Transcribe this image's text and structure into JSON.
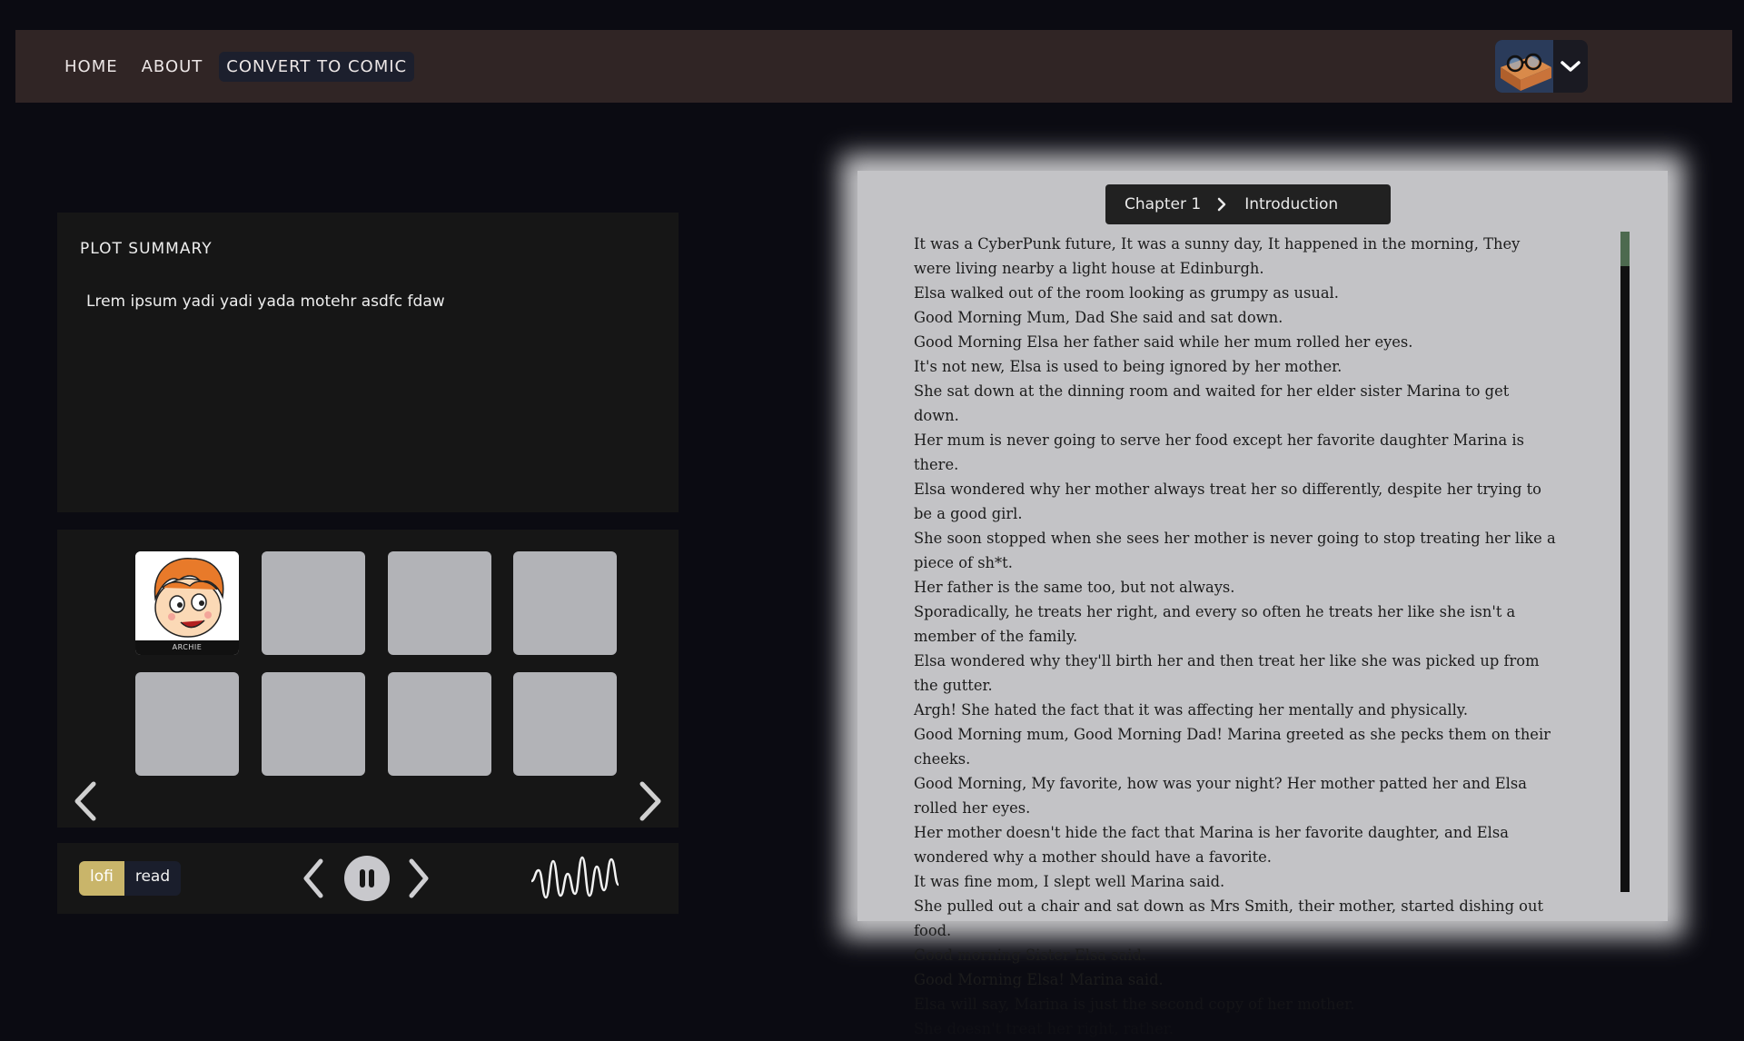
{
  "nav": {
    "home": "HOME",
    "about": "ABOUT",
    "convert": "CONVERT TO COMIC"
  },
  "profile": {
    "avatar_icon": "reading-glasses-book-icon",
    "menu_icon": "chevron-down-icon"
  },
  "plot": {
    "title": "PLOT SUMMARY",
    "text": "Lrem ipsum yadi yadi yada motehr asdfc fdaw"
  },
  "characters": {
    "tiles": [
      {
        "label": "ARCHIE",
        "filled": true
      },
      {
        "label": "",
        "filled": false
      },
      {
        "label": "",
        "filled": false
      },
      {
        "label": "",
        "filled": false
      },
      {
        "label": "",
        "filled": false
      },
      {
        "label": "",
        "filled": false
      },
      {
        "label": "",
        "filled": false
      },
      {
        "label": "",
        "filled": false
      }
    ]
  },
  "player": {
    "mode_lofi": "lofi",
    "mode_read": "read",
    "active_mode": "lofi",
    "state": "playing"
  },
  "reader": {
    "chapter": "Chapter 1",
    "section": "Introduction",
    "paragraphs": [
      "It was a CyberPunk future, It was a sunny day, It happened in the morning, They were living nearby a light house at Edinburgh.",
      "Elsa walked out of the room looking as grumpy as usual.",
      "Good Morning Mum, Dad She said and sat down.",
      "Good Morning Elsa her father said while her mum rolled her eyes.",
      "It's not new, Elsa is used to being ignored by her mother.",
      "She sat down at the dinning room and waited for her elder sister Marina to get down.",
      "Her mum is never going to serve her food except her favorite daughter Marina is there.",
      "Elsa wondered why her mother always treat her so differently, despite her trying to be a good girl.",
      "She soon stopped when she sees her mother is never going to stop treating her like a piece of sh*t.",
      "Her father is the same too, but not always.",
      "Sporadically, he treats her right, and every so often he treats her like she isn't a member of the family.",
      "Elsa wondered why they'll birth her and then treat her like she was picked up from the gutter.",
      "Argh! She hated the fact that it was affecting her mentally and physically.",
      "Good Morning mum, Good Morning Dad! Marina greeted as she pecks them on their cheeks.",
      "Good Morning, My favorite, how was your night? Her mother patted her and Elsa rolled her eyes.",
      "Her mother doesn't hide the fact that Marina is her favorite daughter, and Elsa wondered why a mother should have a favorite.",
      "It was fine mom, I slept well Marina said.",
      "She pulled out a chair and sat down as Mrs Smith, their mother, started dishing out food.",
      "Good morning Sister Elsa said.",
      "Good Morning Elsa! Marina said.",
      "Elsa will say, Marina is just the second copy of her mother.",
      "She doesn't treat her right, rather."
    ]
  },
  "colors": {
    "background": "#0b0b12",
    "topbar": "#302525",
    "panel": "#161616",
    "reader_page": "#c3c3c6",
    "accent_lofi": "#c9b56a",
    "scroll_thumb": "#4d6a4f"
  }
}
